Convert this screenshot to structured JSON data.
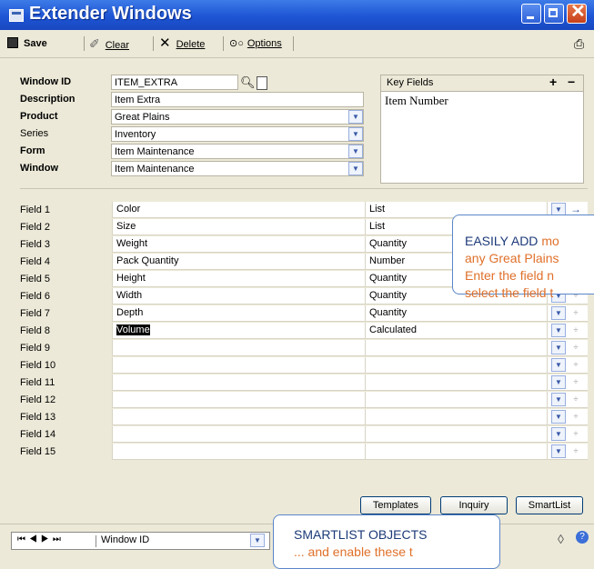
{
  "window": {
    "title": "Extender Windows"
  },
  "toolbar": {
    "save_label": "Save",
    "clear_label": "Clear",
    "delete_label": "Delete",
    "options_label": "Options"
  },
  "form": {
    "window_id_label": "Window ID",
    "window_id_value": "ITEM_EXTRA",
    "description_label": "Description",
    "description_value": "Item Extra",
    "product_label": "Product",
    "product_value": "Great Plains",
    "series_label": "Series",
    "series_value": "Inventory",
    "form_label": "Form",
    "form_value": "Item Maintenance",
    "window_label": "Window",
    "window_value": "Item Maintenance"
  },
  "key_fields": {
    "header": "Key Fields",
    "items": [
      "Item Number"
    ]
  },
  "fields": [
    {
      "name": "Field 1",
      "value": "Color",
      "type": "List"
    },
    {
      "name": "Field 2",
      "value": "Size",
      "type": "List"
    },
    {
      "name": "Field 3",
      "value": "Weight",
      "type": "Quantity"
    },
    {
      "name": "Field 4",
      "value": "Pack Quantity",
      "type": "Number"
    },
    {
      "name": "Field 5",
      "value": "Height",
      "type": "Quantity"
    },
    {
      "name": "Field 6",
      "value": "Width",
      "type": "Quantity"
    },
    {
      "name": "Field 7",
      "value": "Depth",
      "type": "Quantity"
    },
    {
      "name": "Field 8",
      "value": "Volume",
      "type": "Calculated"
    },
    {
      "name": "Field 9",
      "value": "",
      "type": ""
    },
    {
      "name": "Field 10",
      "value": "",
      "type": ""
    },
    {
      "name": "Field 11",
      "value": "",
      "type": ""
    },
    {
      "name": "Field 12",
      "value": "",
      "type": ""
    },
    {
      "name": "Field 13",
      "value": "",
      "type": ""
    },
    {
      "name": "Field 14",
      "value": "",
      "type": ""
    },
    {
      "name": "Field 15",
      "value": "",
      "type": ""
    }
  ],
  "buttons": {
    "templates": "Templates",
    "inquiry": "Inquiry",
    "smartlist": "SmartList"
  },
  "statusbar": {
    "browse_by": "Window ID"
  },
  "callouts": {
    "easily_add": {
      "line1_highlight": "EASILY ADD",
      "line1_rest": "mo",
      "line2": "any Great Plains",
      "line3": "Enter the field n",
      "line4": "select the field t"
    },
    "smartlist": {
      "line1": "SMARTLIST OBJECTS",
      "line2": "... and enable these t"
    }
  },
  "colors": {
    "title_bar": "#1e55d4",
    "callout_highlight": "#e0702a",
    "callout_border": "#5a86c9"
  }
}
